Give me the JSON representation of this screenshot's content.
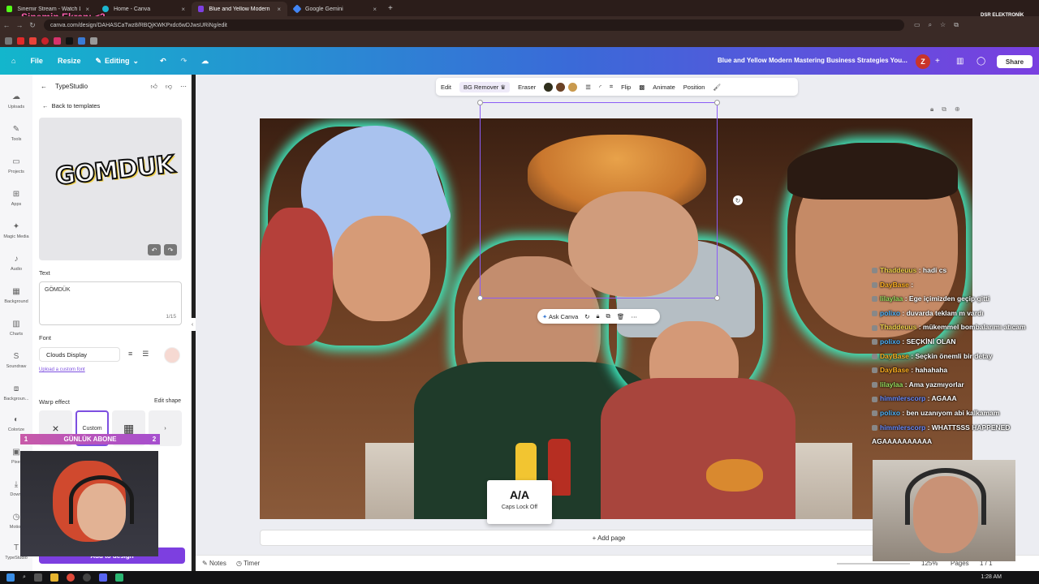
{
  "overlay": {
    "stream_title": "Sinemin Ekranı <3",
    "dsr_label": "DSR ELEKTRONİK",
    "sub_counter": {
      "left": "1",
      "label": "GÜNLÜK ABONE",
      "right": "2"
    }
  },
  "browser": {
    "tabs": [
      {
        "label": "Sinemir Stream - Watch Live on",
        "color": "#53fc18",
        "active": false
      },
      {
        "label": "Home - Canva",
        "color": "#7d3fe0",
        "active": false
      },
      {
        "label": "Blue and Yellow Modern Maste",
        "color": "#7d3fe0",
        "active": true
      },
      {
        "label": "Google Gemini",
        "color": "#4285f4",
        "active": false
      }
    ],
    "url": "canva.com/design/DAHASCaTwz8/RBQjKWKPxdc6wDJwsURiNg/edit"
  },
  "canva_header": {
    "file": "File",
    "resize": "Resize",
    "editing": "Editing",
    "doc_title": "Blue and Yellow Modern Mastering Business Strategies You...",
    "avatar": "Z",
    "share": "Share"
  },
  "rail": [
    {
      "icon": "upload-icon",
      "label": "Uploads"
    },
    {
      "icon": "tools-icon",
      "label": "Tools"
    },
    {
      "icon": "folder-icon",
      "label": "Projects"
    },
    {
      "icon": "apps-icon",
      "label": "Apps"
    },
    {
      "icon": "magic-icon",
      "label": "Magic Media"
    },
    {
      "icon": "music-icon",
      "label": "Audio"
    },
    {
      "icon": "background-icon",
      "label": "Background"
    },
    {
      "icon": "chart-icon",
      "label": "Charts"
    },
    {
      "icon": "soundraw-icon",
      "label": "Soundraw"
    },
    {
      "icon": "bg-remove-icon",
      "label": "Backgroun..."
    },
    {
      "icon": "colorize-icon",
      "label": "Colorize"
    },
    {
      "icon": "pixel-icon",
      "label": "Pixel"
    },
    {
      "icon": "download-icon",
      "label": "Downl"
    },
    {
      "icon": "motion-icon",
      "label": "Motion"
    },
    {
      "icon": "typestudio-icon",
      "label": "TypeStudio"
    }
  ],
  "panel": {
    "title": "TypeStudio",
    "back_to_templates": "Back to templates",
    "preview_text": "GOMDUK",
    "text_label": "Text",
    "text_value": "GÖMDÜK",
    "char_count": "1/15",
    "font_label": "Font",
    "font_name": "Clouds Display",
    "upload_font": "Upload a custom font",
    "warp_label": "Warp effect",
    "edit_shape": "Edit shape",
    "warp_custom": "Custom",
    "add_to_design": "Add to design"
  },
  "toolbar": {
    "edit": "Edit",
    "bg_remover": "BG Remover",
    "eraser": "Eraser",
    "flip": "Flip",
    "animate": "Animate",
    "position": "Position",
    "colors": [
      "#2f2f1c",
      "#6b4226",
      "#c99a4e"
    ]
  },
  "canvas": {
    "ask_canva": "Ask Canva",
    "add_page": "+ Add page",
    "caps_lock": "Caps Lock Off",
    "caps_icon": "A/A"
  },
  "footer": {
    "notes": "Notes",
    "timer": "Timer",
    "zoom": "125%",
    "pages": "Pages",
    "page_count": "1 / 1"
  },
  "chat": [
    {
      "user": "Thaddeuus",
      "msg": "hadi cs",
      "color": "#f0d24a"
    },
    {
      "user": "DayBase",
      "msg": "",
      "color": "#ffb020"
    },
    {
      "user": "lilaylaa",
      "msg": "Ege içimizden geçip gitti",
      "color": "#9be060"
    },
    {
      "user": "polixo",
      "msg": "duvarda teklam m vardı",
      "color": "#4db5ff"
    },
    {
      "user": "Thaddeuus",
      "msg": "mükemmel bombalarımı atıcam",
      "color": "#f0d24a"
    },
    {
      "user": "polixo",
      "msg": "SEÇKİNİ OLAN",
      "color": "#4db5ff"
    },
    {
      "user": "DayBase",
      "msg": "Seçkin önemli bir detay",
      "color": "#ffb020"
    },
    {
      "user": "DayBase",
      "msg": "hahahaha",
      "color": "#ffb020"
    },
    {
      "user": "lilaylaa",
      "msg": "Ama yazmıyorlar",
      "color": "#9be060"
    },
    {
      "user": "himmlerscorp",
      "msg": "AGAAA",
      "color": "#6a8cff"
    },
    {
      "user": "polixo",
      "msg": "ben uzanıyom abi kalkamam",
      "color": "#4db5ff"
    },
    {
      "user": "himmlerscorp",
      "msg": "WHATTSSS HAPPENED AGAAAAAAAAAA",
      "color": "#6a8cff"
    }
  ],
  "taskbar": {
    "time": "1:28 AM"
  }
}
